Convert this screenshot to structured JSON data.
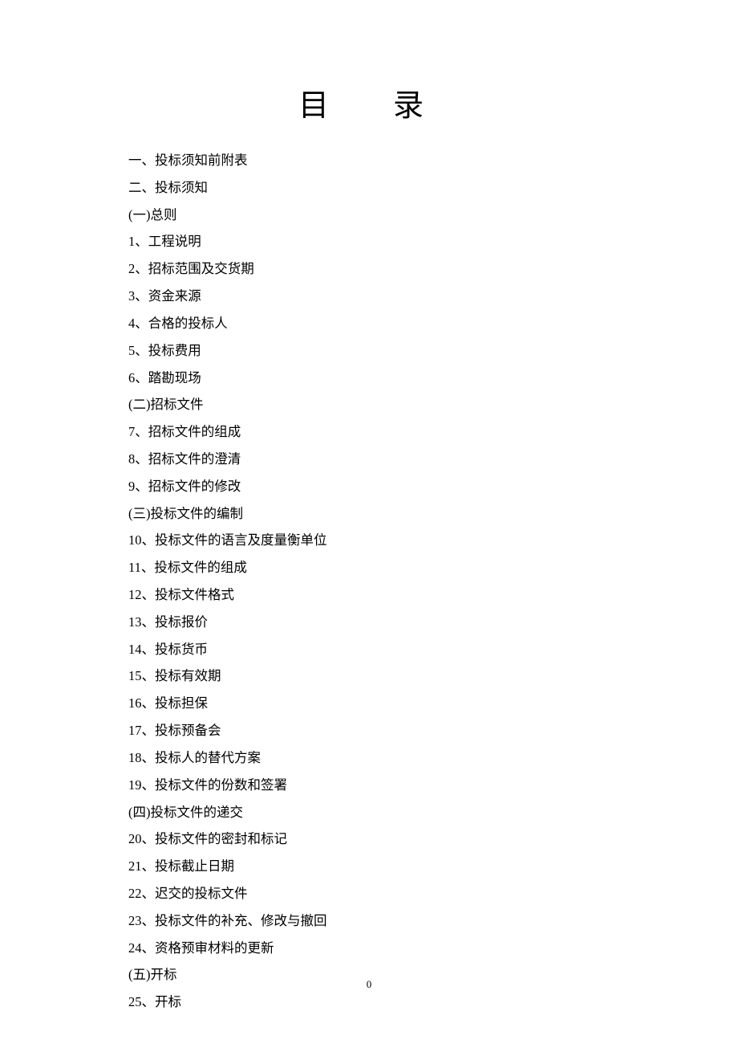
{
  "title": "目录",
  "toc": {
    "items": [
      "一、投标须知前附表",
      "二、投标须知",
      "(一)总则",
      "1、工程说明",
      "2、招标范围及交货期",
      "3、资金来源",
      "4、合格的投标人",
      "5、投标费用",
      "6、踏勘现场",
      "(二)招标文件",
      "7、招标文件的组成",
      "8、招标文件的澄清",
      "9、招标文件的修改",
      "(三)投标文件的编制",
      "10、投标文件的语言及度量衡单位",
      "11、投标文件的组成",
      "12、投标文件格式",
      "13、投标报价",
      "14、投标货币",
      "15、投标有效期",
      "16、投标担保",
      "17、投标预备会",
      "18、投标人的替代方案",
      "19、投标文件的份数和签署",
      "(四)投标文件的递交",
      "20、投标文件的密封和标记",
      "21、投标截止日期",
      "22、迟交的投标文件",
      "23、投标文件的补充、修改与撤回",
      "24、资格预审材料的更新",
      "(五)开标",
      "25、开标"
    ]
  },
  "page_number": "0"
}
